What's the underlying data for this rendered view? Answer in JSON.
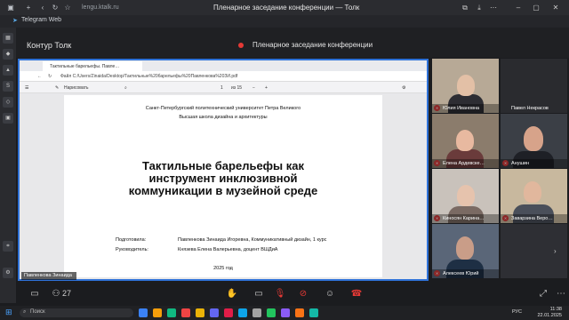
{
  "browser": {
    "url": "lengu.ktalk.ru",
    "window_title": "Пленарное заседание конференции — Толк",
    "bookmark": "Telegram Web"
  },
  "app": {
    "brand": "Контур Толк",
    "meeting_title": "Пленарное заседание конференции",
    "recording_color": "#e53935",
    "accent_color": "#2f72d8"
  },
  "pdf": {
    "tab_label": "Тактильные барельефы. Павле…",
    "path": "Файл  C:/Users/Zinaida/Desktop/Тактильные%20барельефы%20Павленкова%20ЗИ.pdf",
    "tool_draw": "Нарисовать",
    "page_num": "1",
    "page_total": "из 15",
    "page": {
      "university": "Санкт-Петербургский политехнический университет Петра Великого",
      "school": "Высшая школа дизайна и архитектуры",
      "title_line1": "Тактильные барельефы как",
      "title_line2": "инструмент инклюзивной",
      "title_line3": "коммуникации в музейной среде",
      "author_label": "Подготовила:",
      "author_value": "Павленкова Зинаида Игоревна, Коммуникативный дизайн, 1 курс",
      "supervisor_label": "Руководитель:",
      "supervisor_value": "Князева Елена Валерьевна, доцент ВШДиА",
      "year": "2025 год"
    }
  },
  "presenter_name": "Павленкова Зинаида",
  "participants": [
    {
      "name": "Юлия Ивановна"
    },
    {
      "name": "Павел Некрасов"
    },
    {
      "name": "Елена Ардевскe…"
    },
    {
      "name": "Анушин"
    },
    {
      "name": "Киносян Карина…"
    },
    {
      "name": "Заварзина Веро…"
    },
    {
      "name": "Алексеев Юрий"
    },
    {
      "name": ""
    }
  ],
  "controls": {
    "participants_count": "27"
  },
  "taskbar": {
    "search_placeholder": "Поиск",
    "language": "РУС",
    "time": "11:38",
    "date": "22.01.2025"
  }
}
